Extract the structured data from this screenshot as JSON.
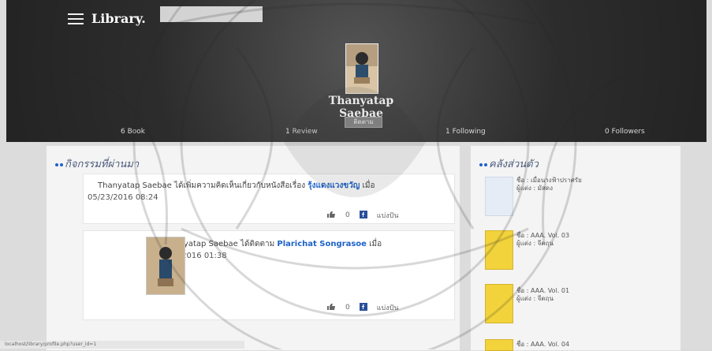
{
  "header": {
    "brand": "Library.",
    "profile_name": "Thanyatap Saebae",
    "follow_button": "ติดตาม",
    "stats": [
      "6 Book",
      "1 Review",
      "1 Following",
      "0 Followers"
    ]
  },
  "sections": {
    "activity_title": "กิจกรรมที่ผ่านมา",
    "shelf_title": "คลังส่วนตัว"
  },
  "activities": [
    {
      "text": "Thanyatap Saebae ได้เพิ่มความคิดเห็นเกี่ยวกับหนังสือเรื่อง",
      "highlight": "รุ้งแดงแวงขวัญ",
      "suffix": "เมื่อ",
      "date": "05/23/2016 08:24",
      "like": "0",
      "share": "แบ่งปัน"
    },
    {
      "text": "Thanyatap Saebae ได้ติดตาม",
      "highlight": "Plarichat Songrasoe",
      "suffix": "เมื่อ",
      "date": "05/22/2016 01:38",
      "like": "0",
      "share": "แบ่งปัน"
    }
  ],
  "shelf": [
    {
      "title": "ชื่อ : เมื่อนางฟ้าปราศรัย",
      "author": "ผู้แต่ง : มัสดง"
    },
    {
      "title": "ชื่อ : AAA. Vol. 03",
      "author": "ผู้แต่ง : จีตฤน"
    },
    {
      "title": "ชื่อ : AAA. Vol. 01",
      "author": "ผู้แต่ง : จีตฤน"
    },
    {
      "title": "ชื่อ : AAA. Vol. 04",
      "author": ""
    }
  ],
  "footer": {
    "status_text": "localhost/library/profile.php?user_id=1"
  },
  "colors": {
    "accent": "#1d62c7",
    "header_bg": "#2f2f2f",
    "panel_bg": "#f4f4f4"
  },
  "icons": {
    "menu": "menu-icon",
    "like": "like-icon",
    "facebook": "facebook-icon"
  }
}
